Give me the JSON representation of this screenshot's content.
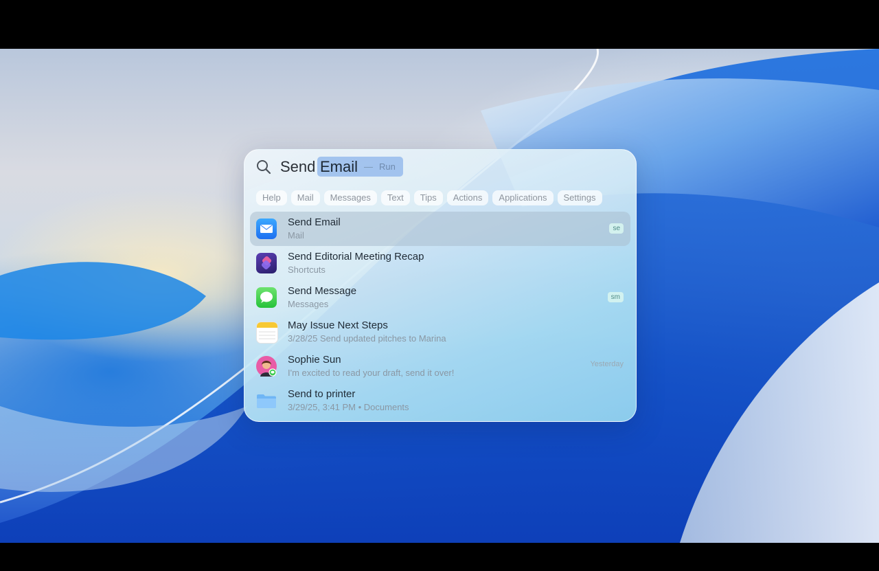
{
  "search": {
    "query_prefix": "Send",
    "query_suggestion": "Email",
    "separator": "—",
    "action_hint": "Run"
  },
  "filters": [
    "Help",
    "Mail",
    "Messages",
    "Text",
    "Tips",
    "Actions",
    "Applications",
    "Settings"
  ],
  "results": [
    {
      "title": "Send Email",
      "subtitle": "Mail",
      "shortcut": "se",
      "icon": "mail-icon",
      "selected": true
    },
    {
      "title": "Send Editorial Meeting Recap",
      "subtitle": "Shortcuts",
      "icon": "shortcuts-icon"
    },
    {
      "title": "Send Message",
      "subtitle": "Messages",
      "shortcut": "sm",
      "icon": "messages-icon"
    },
    {
      "title": "May Issue Next Steps",
      "subtitle": "3/28/25 Send updated pitches to Marina",
      "icon": "notes-icon"
    },
    {
      "title": "Sophie Sun",
      "subtitle": "I'm excited to read your draft, send it over!",
      "meta": "Yesterday",
      "icon": "avatar-icon"
    },
    {
      "title": "Send to printer",
      "subtitle": "3/29/25, 3:41 PM • Documents",
      "icon": "folder-icon"
    }
  ],
  "colors": {
    "selection": "#aabecd",
    "accent": "#1e6ff0"
  }
}
